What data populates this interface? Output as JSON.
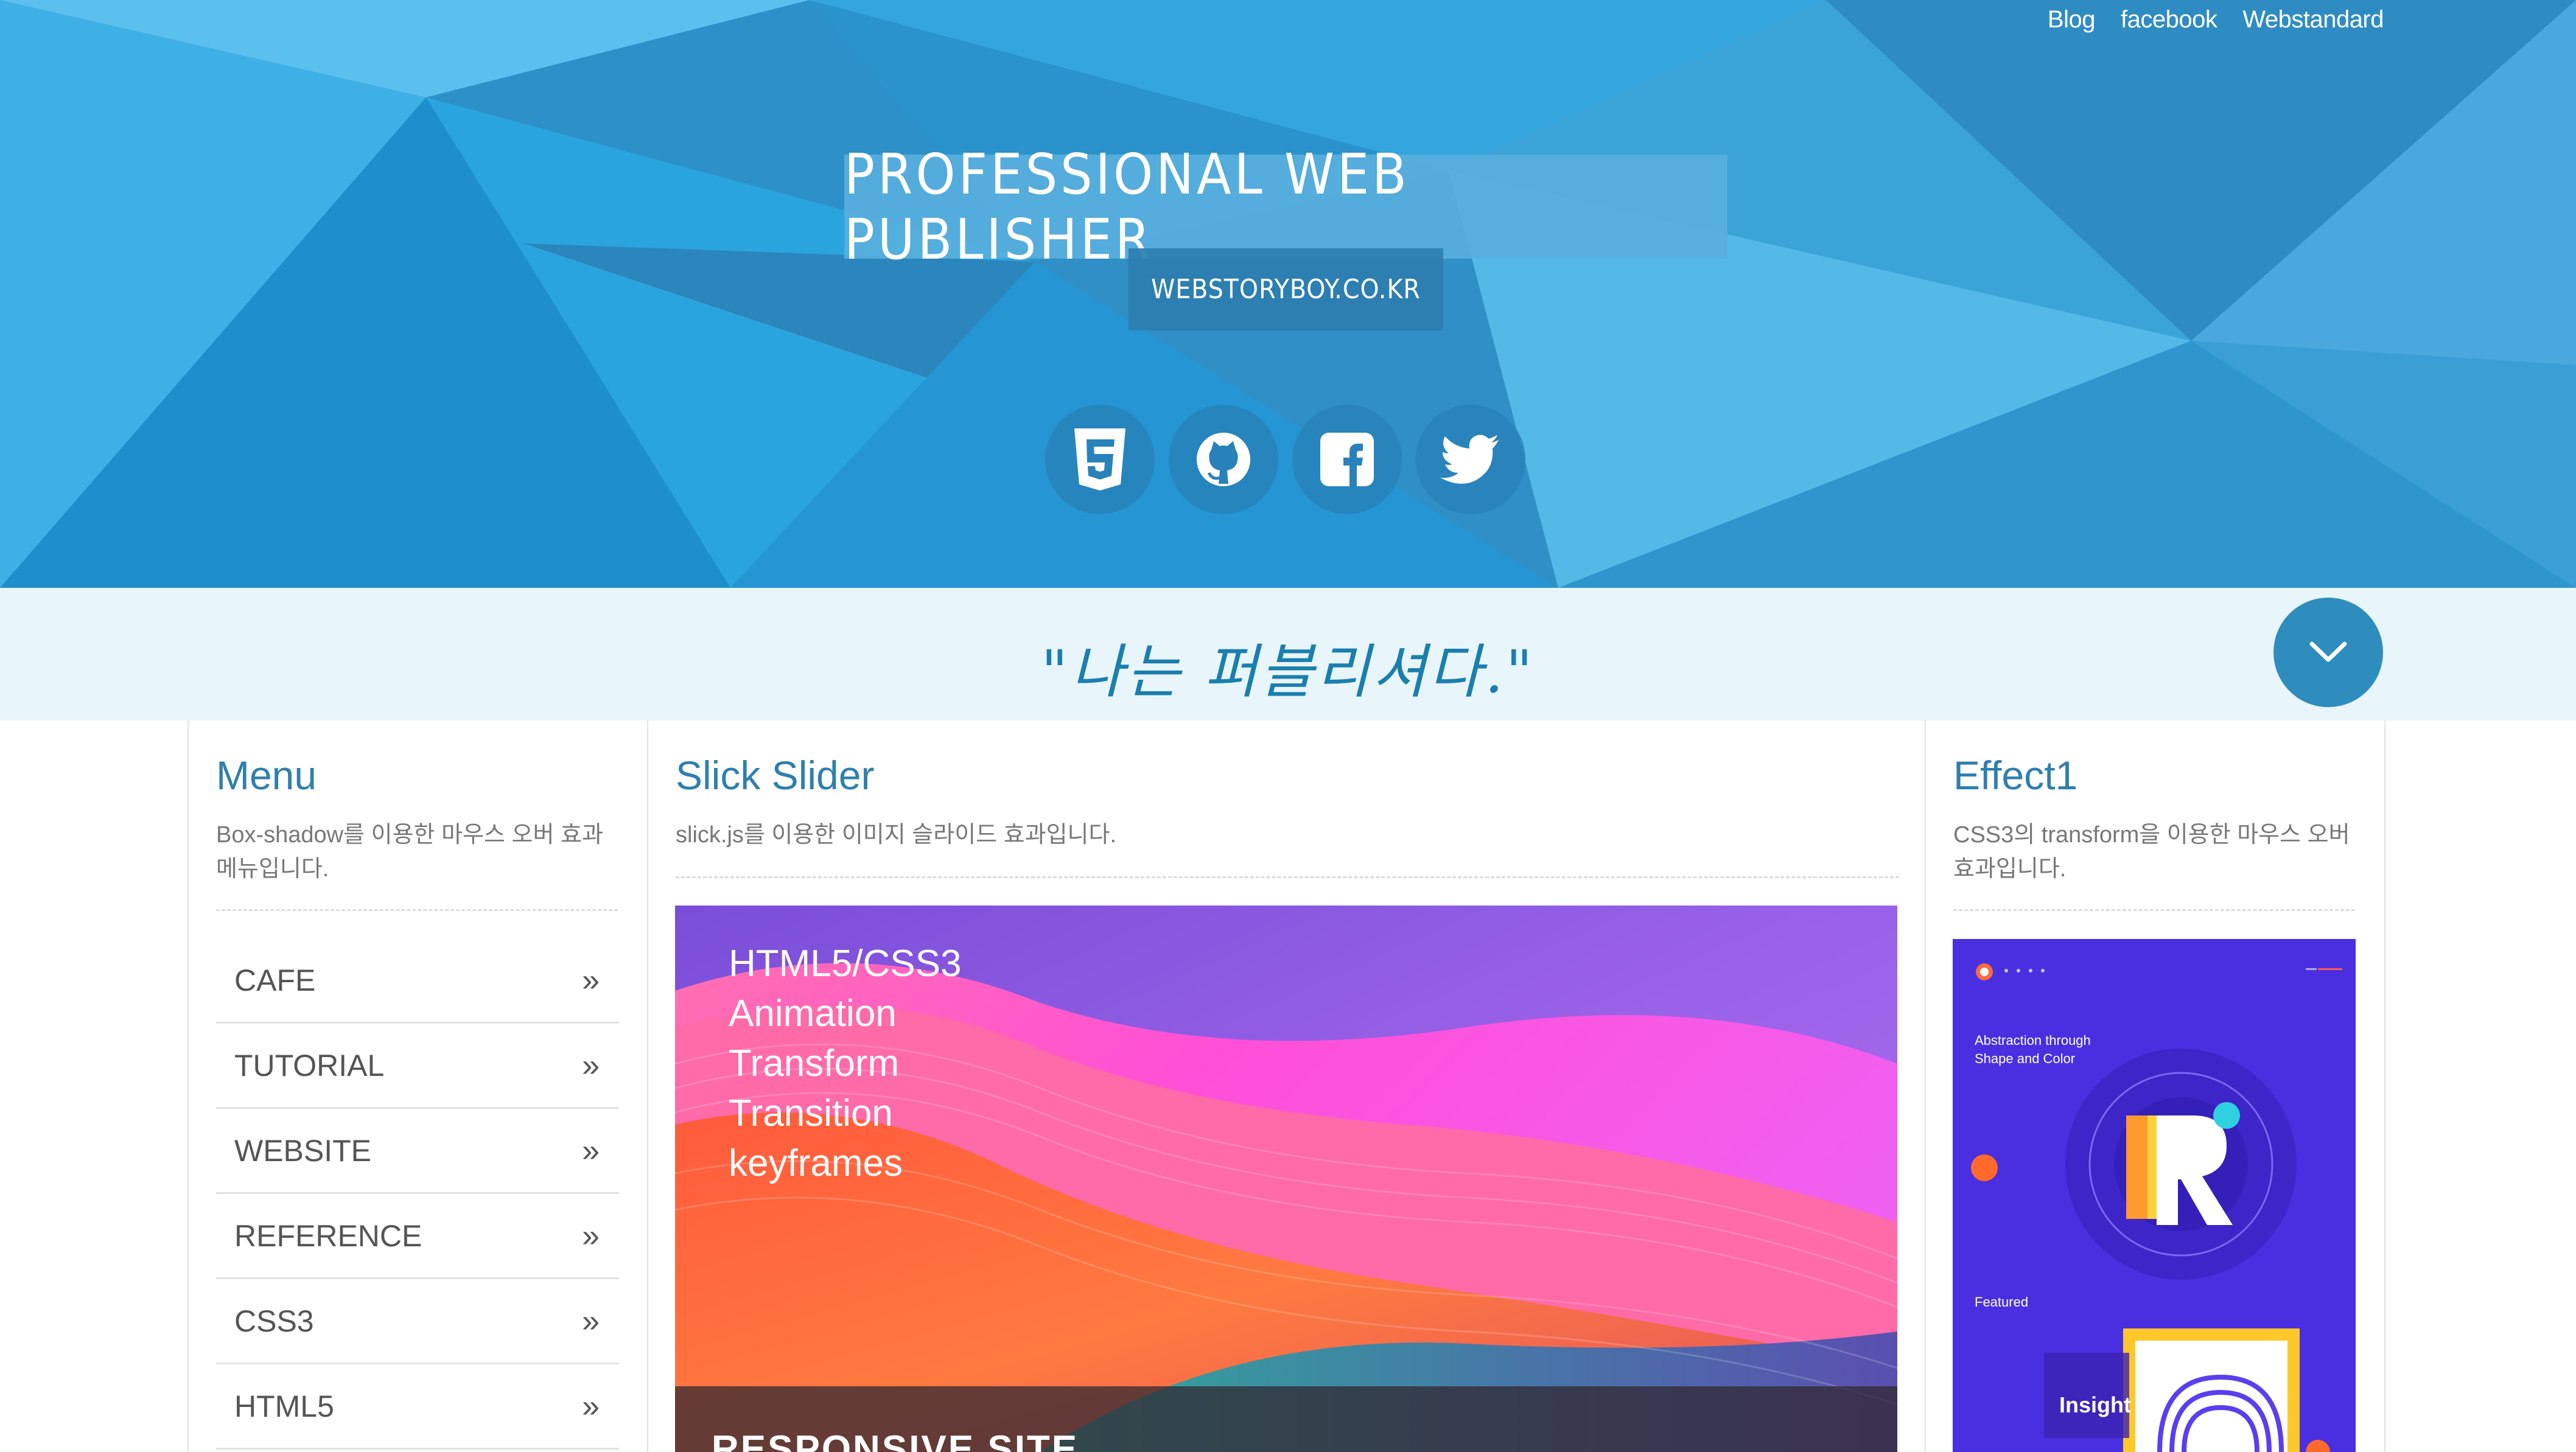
{
  "header": {
    "top_links": [
      "Blog",
      "facebook",
      "Webstandard"
    ],
    "title": "PROFESSIONAL WEB PUBLISHER",
    "subtitle": "WEBSTORYBOY.CO.KR",
    "social_icons": [
      "html5-icon",
      "github-icon",
      "facebook-icon",
      "twitter-icon"
    ]
  },
  "quote": {
    "text": "\"나는 퍼블리셔다.\""
  },
  "menu": {
    "title": "Menu",
    "description": "Box-shadow를 이용한 마우스 오버 효과 메뉴입니다.",
    "items": [
      "CAFE",
      "TUTORIAL",
      "WEBSITE",
      "REFERENCE",
      "CSS3",
      "HTML5"
    ]
  },
  "slider": {
    "title": "Slick Slider",
    "description": "slick.js를 이용한 이미지 슬라이드 효과입니다.",
    "slide_lines": [
      "HTML5/CSS3",
      "Animation",
      "Transform",
      "Transition",
      "keyframes"
    ],
    "caption": "RESPONSIVE SITE"
  },
  "effect": {
    "title": "Effect1",
    "description": "CSS3의 transform을 이용한 마우스 오버효과입니다.",
    "image_texts": [
      "Abstraction through",
      "Shape and Color",
      "Featured",
      "Insight"
    ]
  },
  "colors": {
    "header_bg": "#2a9ad3",
    "title_box": "#58afdd",
    "subtitle_box": "#2e7eb0",
    "quote_bg": "#e8f5fb",
    "accent": "#2f7fae"
  }
}
